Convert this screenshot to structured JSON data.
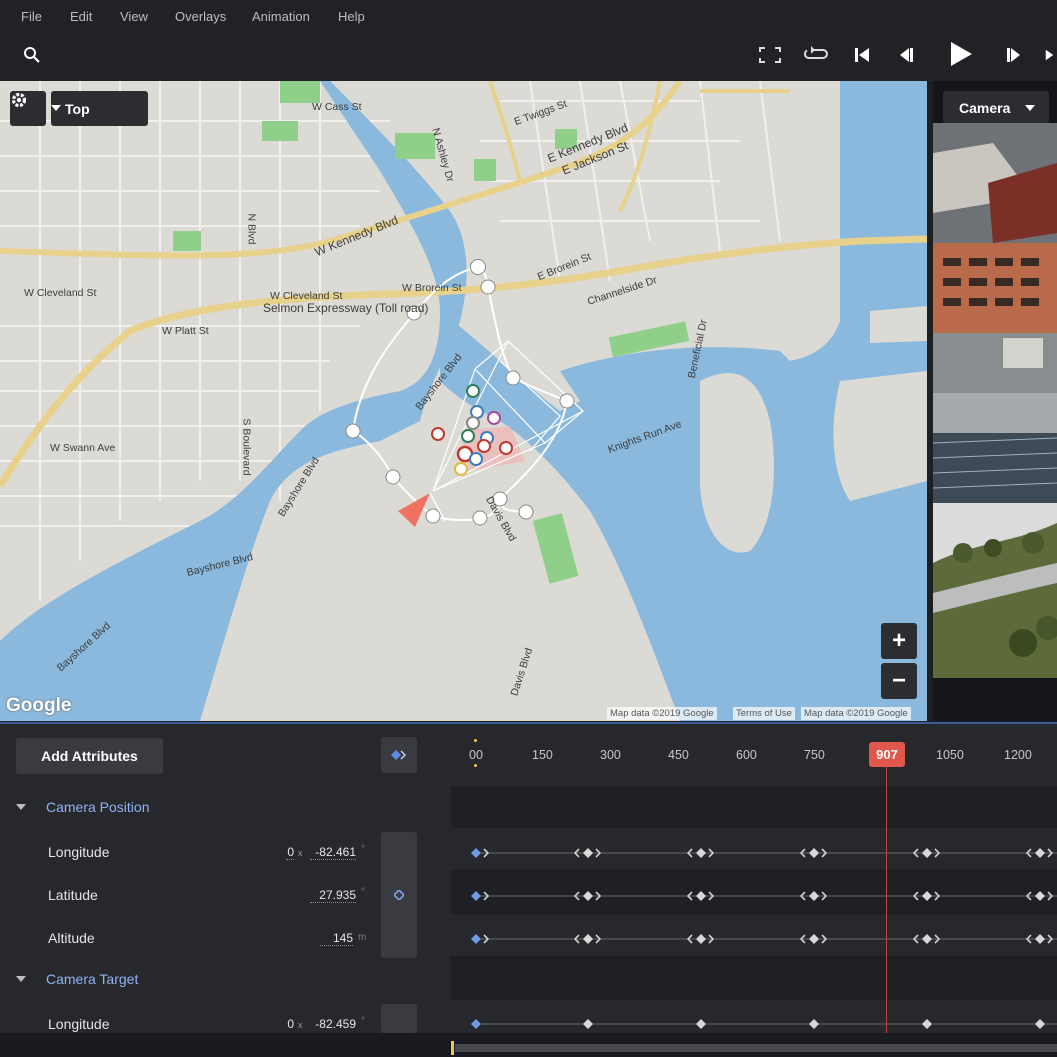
{
  "menu": {
    "items": [
      "File",
      "Edit",
      "View",
      "Overlays",
      "Animation",
      "Help"
    ]
  },
  "toolbar": {
    "search_icon": "search-icon",
    "playback": [
      "fullscreen-icon",
      "loop-icon",
      "skip-to-start-icon",
      "step-back-icon",
      "play-icon",
      "step-forward-icon",
      "skip-to-end-icon"
    ]
  },
  "map": {
    "view_label": "Top",
    "labels": {
      "w_cass": "W Cass St",
      "e_twiggs": "E Twiggs St",
      "n_ashley": "N Ashley Dr",
      "e_kennedy": "E Kennedy Blvd",
      "e_jackson": "E Jackson St",
      "n_blvd": "N Blvd",
      "w_kennedy": "W Kennedy Blvd",
      "e_brorein": "E Brorein St",
      "w_brorein": "W Brorein St",
      "w_cleveland": "W Cleveland St",
      "w_cleveland2": "W Cleveland St",
      "channelside": "Channelside Dr",
      "selmon": "Selmon Expressway (Toll road)",
      "w_platt": "W Platt St",
      "bayshore_blvd1": "Bayshore Blvd",
      "beneficial": "Beneficial Dr",
      "w_swann": "W Swann Ave",
      "s_boulevard": "S Boulevard",
      "knights_run": "Knights Run Ave",
      "bayshore_blvd2": "Bayshore Blvd",
      "davis_blvd1": "Davis Blvd",
      "bayshore_blvd3": "Bayshore Blvd",
      "bayshore_blvd4": "Bayshore Blvd",
      "davis_blvd2": "Davis Blvd"
    },
    "google_logo": "Google",
    "attribution": {
      "map_data": "Map data ©2019 Google",
      "terms": "Terms of Use",
      "map_data2": "Map data ©2019 Google"
    },
    "zoom_in": "+",
    "zoom_out": "−",
    "colors": {
      "water": "#8ab9dd",
      "land": "#dcdad5",
      "park": "#8fcf8a",
      "highway": "#e8d18a"
    }
  },
  "camera_panel": {
    "label": "Camera"
  },
  "timeline": {
    "add_attributes": "Add Attributes",
    "ticks": [
      "00",
      "150",
      "300",
      "450",
      "600",
      "750",
      "1050",
      "1200"
    ],
    "current_frame": "907",
    "sections": [
      {
        "title": "Camera Position",
        "attributes": [
          {
            "label": "Longitude",
            "offset": "0",
            "x_label": "x",
            "value": "-82.461",
            "unit": "°"
          },
          {
            "label": "Latitude",
            "value": "27.935",
            "unit": "°"
          },
          {
            "label": "Altitude",
            "value": "145",
            "unit": "m"
          }
        ]
      },
      {
        "title": "Camera Target",
        "attributes": [
          {
            "label": "Longitude",
            "offset": "0",
            "x_label": "x",
            "value": "-82.459",
            "unit": "°"
          }
        ]
      }
    ],
    "accent": "#8fb3f5",
    "playhead_color": "#e2574c"
  }
}
